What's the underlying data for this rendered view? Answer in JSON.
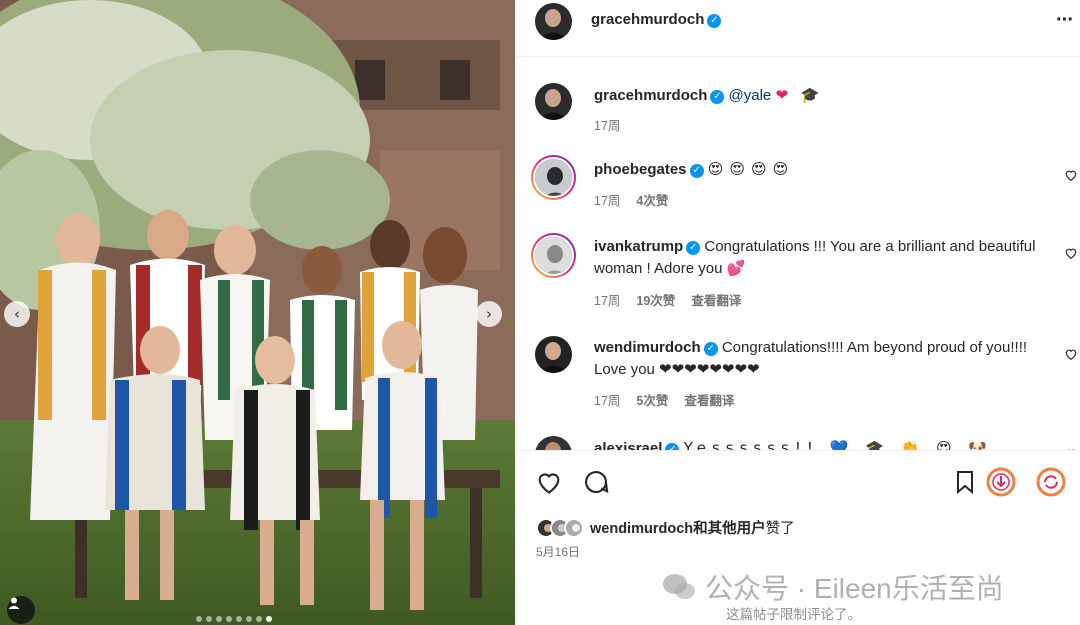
{
  "post": {
    "author": "gracehmurdoch",
    "more_icon": "more-options-icon",
    "photo_alt_icons": {
      "prev": "‹",
      "next": "›"
    },
    "carousel": {
      "count": 8,
      "active_index": 7
    }
  },
  "caption": {
    "username": "gracehmurdoch",
    "mention": "@yale",
    "emoji": "❤ 🎓",
    "time": "17周"
  },
  "comments": [
    {
      "username": "phoebegates",
      "text": "😍😍😍😍",
      "time": "17周",
      "likes": "4次赞",
      "translate": ""
    },
    {
      "username": "ivankatrump",
      "text": "Congratulations !!! You are a brilliant and beautiful woman ! Adore you 💕",
      "time": "17周",
      "likes": "19次赞",
      "translate": "查看翻译"
    },
    {
      "username": "wendimurdoch",
      "text": "Congratulations!!!! Am beyond proud of you!!!! Love you ❤❤❤❤❤❤❤❤",
      "time": "17周",
      "likes": "5次赞",
      "translate": "查看翻译"
    },
    {
      "username": "alexisrael",
      "text": "Yessssss!! 💙 🎓 👏 😍 🐶",
      "time": "",
      "likes": "",
      "translate": ""
    }
  ],
  "likes": {
    "user": "wendimurdoch",
    "suffix_bold": "和其他用户",
    "suffix": "赞了"
  },
  "date": "5月16日",
  "watermark": "公众号 · Eileen乐活至尚",
  "restricted_notice": "这篇帖子限制评论了。",
  "colors": {
    "verified": "#0095f6",
    "link": "#00376b",
    "meta": "#737373",
    "heart": "#e8245f"
  }
}
